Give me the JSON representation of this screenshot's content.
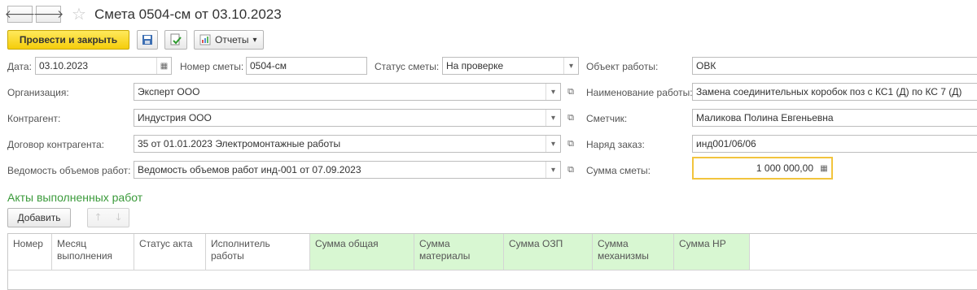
{
  "window": {
    "title": "Смета 0504-см от 03.10.2023"
  },
  "nav": {
    "back": "🡐",
    "forward": "🡒",
    "star": "☆"
  },
  "toolbar": {
    "post_close": "Провести и закрыть",
    "reports": "Отчеты",
    "reports_arrow": "▾"
  },
  "form": {
    "date_label": "Дата:",
    "date_value": "03.10.2023",
    "number_label": "Номер сметы:",
    "number_value": "0504-см",
    "status_label": "Статус сметы:",
    "status_value": "На проверке",
    "object_label": "Объект работы:",
    "object_value": "ОВК",
    "org_label": "Организация:",
    "org_value": "Эксперт ООО",
    "workname_label": "Наименование работы:",
    "workname_value": "Замена соединительных коробок поз с КС1 (Д) по КС 7 (Д)",
    "contractor_label": "Контрагент:",
    "contractor_value": "Индустрия ООО",
    "estimator_label": "Сметчик:",
    "estimator_value": "Маликова Полина Евгеньевна",
    "contract_label": "Договор контрагента:",
    "contract_value": "35 от 01.01.2023 Электромонтажные работы",
    "order_label": "Наряд заказ:",
    "order_value": "инд001/06/06",
    "statement_label": "Ведомость объемов работ:",
    "statement_value": "Ведомость объемов работ инд-001 от 07.09.2023",
    "sum_label": "Сумма сметы:",
    "sum_value": "1 000 000,00"
  },
  "acts": {
    "title": "Акты выполненных работ",
    "add": "Добавить",
    "columns": [
      "Номер",
      "Месяц выполнения",
      "Статус акта",
      "Исполнитель работы",
      "Сумма общая",
      "Сумма материалы",
      "Сумма ОЗП",
      "Сумма механизмы",
      "Сумма НР"
    ]
  },
  "icons": {
    "dropdown": "▾",
    "open": "⧉",
    "calendar": "▦",
    "calc": "▦",
    "up": "🡑",
    "down": "🡓"
  }
}
